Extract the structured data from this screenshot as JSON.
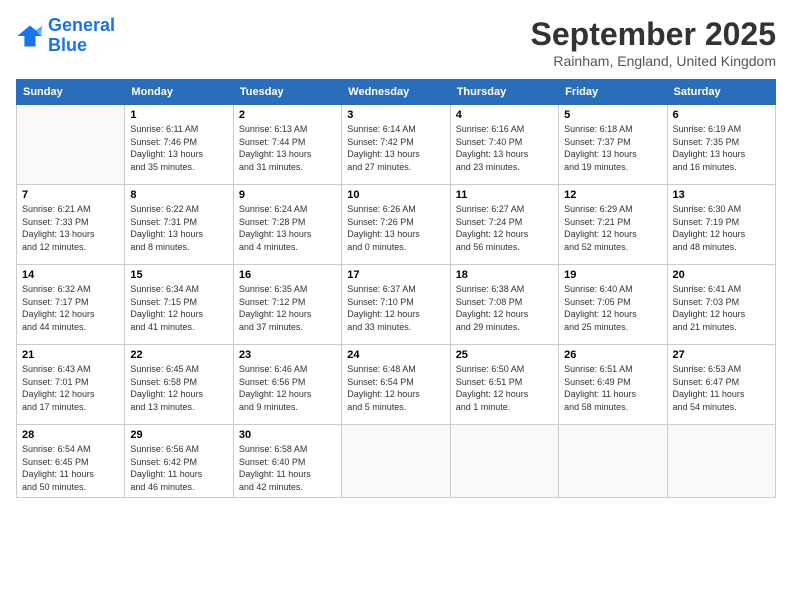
{
  "logo": {
    "line1": "General",
    "line2": "Blue"
  },
  "title": "September 2025",
  "subtitle": "Rainham, England, United Kingdom",
  "weekdays": [
    "Sunday",
    "Monday",
    "Tuesday",
    "Wednesday",
    "Thursday",
    "Friday",
    "Saturday"
  ],
  "weeks": [
    [
      {
        "num": "",
        "info": ""
      },
      {
        "num": "1",
        "info": "Sunrise: 6:11 AM\nSunset: 7:46 PM\nDaylight: 13 hours\nand 35 minutes."
      },
      {
        "num": "2",
        "info": "Sunrise: 6:13 AM\nSunset: 7:44 PM\nDaylight: 13 hours\nand 31 minutes."
      },
      {
        "num": "3",
        "info": "Sunrise: 6:14 AM\nSunset: 7:42 PM\nDaylight: 13 hours\nand 27 minutes."
      },
      {
        "num": "4",
        "info": "Sunrise: 6:16 AM\nSunset: 7:40 PM\nDaylight: 13 hours\nand 23 minutes."
      },
      {
        "num": "5",
        "info": "Sunrise: 6:18 AM\nSunset: 7:37 PM\nDaylight: 13 hours\nand 19 minutes."
      },
      {
        "num": "6",
        "info": "Sunrise: 6:19 AM\nSunset: 7:35 PM\nDaylight: 13 hours\nand 16 minutes."
      }
    ],
    [
      {
        "num": "7",
        "info": "Sunrise: 6:21 AM\nSunset: 7:33 PM\nDaylight: 13 hours\nand 12 minutes."
      },
      {
        "num": "8",
        "info": "Sunrise: 6:22 AM\nSunset: 7:31 PM\nDaylight: 13 hours\nand 8 minutes."
      },
      {
        "num": "9",
        "info": "Sunrise: 6:24 AM\nSunset: 7:28 PM\nDaylight: 13 hours\nand 4 minutes."
      },
      {
        "num": "10",
        "info": "Sunrise: 6:26 AM\nSunset: 7:26 PM\nDaylight: 13 hours\nand 0 minutes."
      },
      {
        "num": "11",
        "info": "Sunrise: 6:27 AM\nSunset: 7:24 PM\nDaylight: 12 hours\nand 56 minutes."
      },
      {
        "num": "12",
        "info": "Sunrise: 6:29 AM\nSunset: 7:21 PM\nDaylight: 12 hours\nand 52 minutes."
      },
      {
        "num": "13",
        "info": "Sunrise: 6:30 AM\nSunset: 7:19 PM\nDaylight: 12 hours\nand 48 minutes."
      }
    ],
    [
      {
        "num": "14",
        "info": "Sunrise: 6:32 AM\nSunset: 7:17 PM\nDaylight: 12 hours\nand 44 minutes."
      },
      {
        "num": "15",
        "info": "Sunrise: 6:34 AM\nSunset: 7:15 PM\nDaylight: 12 hours\nand 41 minutes."
      },
      {
        "num": "16",
        "info": "Sunrise: 6:35 AM\nSunset: 7:12 PM\nDaylight: 12 hours\nand 37 minutes."
      },
      {
        "num": "17",
        "info": "Sunrise: 6:37 AM\nSunset: 7:10 PM\nDaylight: 12 hours\nand 33 minutes."
      },
      {
        "num": "18",
        "info": "Sunrise: 6:38 AM\nSunset: 7:08 PM\nDaylight: 12 hours\nand 29 minutes."
      },
      {
        "num": "19",
        "info": "Sunrise: 6:40 AM\nSunset: 7:05 PM\nDaylight: 12 hours\nand 25 minutes."
      },
      {
        "num": "20",
        "info": "Sunrise: 6:41 AM\nSunset: 7:03 PM\nDaylight: 12 hours\nand 21 minutes."
      }
    ],
    [
      {
        "num": "21",
        "info": "Sunrise: 6:43 AM\nSunset: 7:01 PM\nDaylight: 12 hours\nand 17 minutes."
      },
      {
        "num": "22",
        "info": "Sunrise: 6:45 AM\nSunset: 6:58 PM\nDaylight: 12 hours\nand 13 minutes."
      },
      {
        "num": "23",
        "info": "Sunrise: 6:46 AM\nSunset: 6:56 PM\nDaylight: 12 hours\nand 9 minutes."
      },
      {
        "num": "24",
        "info": "Sunrise: 6:48 AM\nSunset: 6:54 PM\nDaylight: 12 hours\nand 5 minutes."
      },
      {
        "num": "25",
        "info": "Sunrise: 6:50 AM\nSunset: 6:51 PM\nDaylight: 12 hours\nand 1 minute."
      },
      {
        "num": "26",
        "info": "Sunrise: 6:51 AM\nSunset: 6:49 PM\nDaylight: 11 hours\nand 58 minutes."
      },
      {
        "num": "27",
        "info": "Sunrise: 6:53 AM\nSunset: 6:47 PM\nDaylight: 11 hours\nand 54 minutes."
      }
    ],
    [
      {
        "num": "28",
        "info": "Sunrise: 6:54 AM\nSunset: 6:45 PM\nDaylight: 11 hours\nand 50 minutes."
      },
      {
        "num": "29",
        "info": "Sunrise: 6:56 AM\nSunset: 6:42 PM\nDaylight: 11 hours\nand 46 minutes."
      },
      {
        "num": "30",
        "info": "Sunrise: 6:58 AM\nSunset: 6:40 PM\nDaylight: 11 hours\nand 42 minutes."
      },
      {
        "num": "",
        "info": ""
      },
      {
        "num": "",
        "info": ""
      },
      {
        "num": "",
        "info": ""
      },
      {
        "num": "",
        "info": ""
      }
    ]
  ]
}
